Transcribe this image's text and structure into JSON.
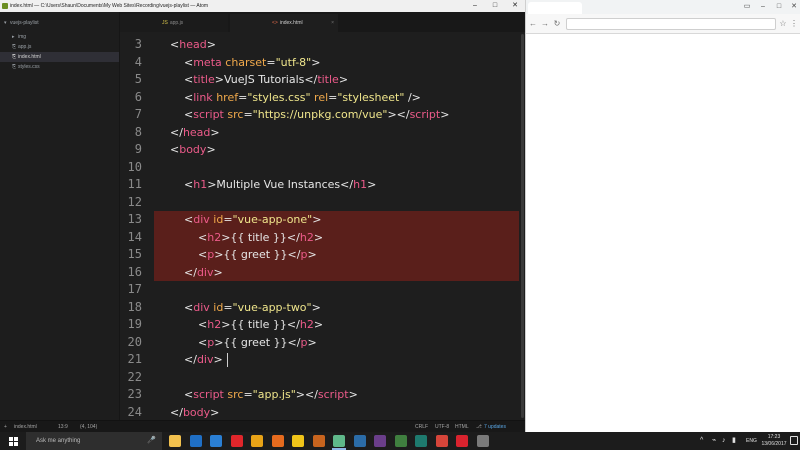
{
  "atom": {
    "title": "index.html — C:\\Users\\Shaun\\Documents\\My Web Sites\\Recording\\vuejs-playlist — Atom",
    "tree": [
      {
        "label": "vuejs-playlist",
        "icon": "folder-open-icon"
      },
      {
        "label": "img",
        "icon": "folder-icon"
      },
      {
        "label": "app.js",
        "icon": "file-js-icon"
      },
      {
        "label": "index.html",
        "icon": "file-html-icon",
        "selected": true
      },
      {
        "label": "styles.css",
        "icon": "file-css-icon"
      }
    ],
    "tabs": [
      {
        "label": "app.js",
        "kind": "js"
      },
      {
        "label": "index.html",
        "kind": "html",
        "active": true
      }
    ],
    "code": [
      {
        "n": "3",
        "indent": 1,
        "tokens": [
          [
            "punc",
            "<"
          ],
          [
            "tag",
            "head"
          ],
          [
            "punc",
            ">"
          ]
        ]
      },
      {
        "n": "4",
        "indent": 2,
        "tokens": [
          [
            "punc",
            "<"
          ],
          [
            "tag",
            "meta"
          ],
          [
            "txt",
            " "
          ],
          [
            "attr",
            "charset"
          ],
          [
            "punc",
            "="
          ],
          [
            "str",
            "\"utf-8\""
          ],
          [
            "punc",
            ">"
          ]
        ]
      },
      {
        "n": "5",
        "indent": 2,
        "tokens": [
          [
            "punc",
            "<"
          ],
          [
            "tag",
            "title"
          ],
          [
            "punc",
            ">"
          ],
          [
            "txt",
            "VueJS Tutorials"
          ],
          [
            "punc",
            "</"
          ],
          [
            "tag",
            "title"
          ],
          [
            "punc",
            ">"
          ]
        ]
      },
      {
        "n": "6",
        "indent": 2,
        "tokens": [
          [
            "punc",
            "<"
          ],
          [
            "tag",
            "link"
          ],
          [
            "txt",
            " "
          ],
          [
            "attr",
            "href"
          ],
          [
            "punc",
            "="
          ],
          [
            "str",
            "\"styles.css\""
          ],
          [
            "txt",
            " "
          ],
          [
            "attr",
            "rel"
          ],
          [
            "punc",
            "="
          ],
          [
            "str",
            "\"stylesheet\""
          ],
          [
            "txt",
            " "
          ],
          [
            "punc",
            "/>"
          ]
        ]
      },
      {
        "n": "7",
        "indent": 2,
        "tokens": [
          [
            "punc",
            "<"
          ],
          [
            "tag",
            "script"
          ],
          [
            "txt",
            " "
          ],
          [
            "attr",
            "src"
          ],
          [
            "punc",
            "="
          ],
          [
            "str",
            "\"https://unpkg.com/vue\""
          ],
          [
            "punc",
            "></"
          ],
          [
            "tag",
            "script"
          ],
          [
            "punc",
            ">"
          ]
        ]
      },
      {
        "n": "8",
        "indent": 1,
        "tokens": [
          [
            "punc",
            "</"
          ],
          [
            "tag",
            "head"
          ],
          [
            "punc",
            ">"
          ]
        ]
      },
      {
        "n": "9",
        "indent": 1,
        "tokens": [
          [
            "punc",
            "<"
          ],
          [
            "tag",
            "body"
          ],
          [
            "punc",
            ">"
          ]
        ]
      },
      {
        "n": "10",
        "indent": 0,
        "tokens": []
      },
      {
        "n": "11",
        "indent": 2,
        "tokens": [
          [
            "punc",
            "<"
          ],
          [
            "tag",
            "h1"
          ],
          [
            "punc",
            ">"
          ],
          [
            "txt",
            "Multiple Vue Instances"
          ],
          [
            "punc",
            "</"
          ],
          [
            "tag",
            "h1"
          ],
          [
            "punc",
            ">"
          ]
        ]
      },
      {
        "n": "12",
        "indent": 0,
        "tokens": []
      },
      {
        "n": "13",
        "indent": 2,
        "hl": true,
        "tokens": [
          [
            "punc",
            "<"
          ],
          [
            "tag",
            "div"
          ],
          [
            "txt",
            " "
          ],
          [
            "attr",
            "id"
          ],
          [
            "punc",
            "="
          ],
          [
            "str",
            "\"vue-app-one\""
          ],
          [
            "punc",
            ">"
          ]
        ]
      },
      {
        "n": "14",
        "indent": 3,
        "hl": true,
        "tokens": [
          [
            "punc",
            "<"
          ],
          [
            "tag",
            "h2"
          ],
          [
            "punc",
            ">"
          ],
          [
            "txt",
            "{{ title }}"
          ],
          [
            "punc",
            "</"
          ],
          [
            "tag",
            "h2"
          ],
          [
            "punc",
            ">"
          ]
        ]
      },
      {
        "n": "15",
        "indent": 3,
        "hl": true,
        "tokens": [
          [
            "punc",
            "<"
          ],
          [
            "tag",
            "p"
          ],
          [
            "punc",
            ">"
          ],
          [
            "txt",
            "{{ greet }}"
          ],
          [
            "punc",
            "</"
          ],
          [
            "tag",
            "p"
          ],
          [
            "punc",
            ">"
          ]
        ]
      },
      {
        "n": "16",
        "indent": 2,
        "hl": true,
        "tokens": [
          [
            "punc",
            "</"
          ],
          [
            "tag",
            "div"
          ],
          [
            "punc",
            ">"
          ]
        ]
      },
      {
        "n": "17",
        "indent": 0,
        "tokens": []
      },
      {
        "n": "18",
        "indent": 2,
        "tokens": [
          [
            "punc",
            "<"
          ],
          [
            "tag",
            "div"
          ],
          [
            "txt",
            " "
          ],
          [
            "attr",
            "id"
          ],
          [
            "punc",
            "="
          ],
          [
            "str",
            "\"vue-app-two\""
          ],
          [
            "punc",
            ">"
          ]
        ]
      },
      {
        "n": "19",
        "indent": 3,
        "tokens": [
          [
            "punc",
            "<"
          ],
          [
            "tag",
            "h2"
          ],
          [
            "punc",
            ">"
          ],
          [
            "txt",
            "{{ title }}"
          ],
          [
            "punc",
            "</"
          ],
          [
            "tag",
            "h2"
          ],
          [
            "punc",
            ">"
          ]
        ]
      },
      {
        "n": "20",
        "indent": 3,
        "tokens": [
          [
            "punc",
            "<"
          ],
          [
            "tag",
            "p"
          ],
          [
            "punc",
            ">"
          ],
          [
            "txt",
            "{{ greet }}"
          ],
          [
            "punc",
            "</"
          ],
          [
            "tag",
            "p"
          ],
          [
            "punc",
            ">"
          ]
        ]
      },
      {
        "n": "21",
        "indent": 2,
        "tokens": [
          [
            "punc",
            "</"
          ],
          [
            "tag",
            "div"
          ],
          [
            "punc",
            ">"
          ]
        ]
      },
      {
        "n": "22",
        "indent": 0,
        "tokens": []
      },
      {
        "n": "23",
        "indent": 2,
        "tokens": [
          [
            "punc",
            "<"
          ],
          [
            "tag",
            "script"
          ],
          [
            "txt",
            " "
          ],
          [
            "attr",
            "src"
          ],
          [
            "punc",
            "="
          ],
          [
            "str",
            "\"app.js\""
          ],
          [
            "punc",
            "></"
          ],
          [
            "tag",
            "script"
          ],
          [
            "punc",
            ">"
          ]
        ]
      },
      {
        "n": "24",
        "indent": 1,
        "tokens": [
          [
            "punc",
            "</"
          ],
          [
            "tag",
            "body"
          ],
          [
            "punc",
            ">"
          ]
        ]
      }
    ],
    "status": {
      "file": "index.html",
      "position": "13:9",
      "selection": "(4, 104)",
      "line_ending": "CRLF",
      "encoding": "UTF-8",
      "grammar": "HTML",
      "updates": "7 updates"
    }
  },
  "browser": {
    "url": ""
  },
  "taskbar": {
    "search_placeholder": "Ask me anything",
    "apps": [
      {
        "name": "file-explorer-icon",
        "color": "#f2c14e"
      },
      {
        "name": "outlook-icon",
        "color": "#1f6fc5"
      },
      {
        "name": "app-icon-blue",
        "color": "#2a7fd4"
      },
      {
        "name": "opera-icon",
        "color": "#e0262b"
      },
      {
        "name": "chrome-icon",
        "color": "#e8a317"
      },
      {
        "name": "firefox-icon",
        "color": "#e66b1e"
      },
      {
        "name": "app-icon-yellow",
        "color": "#f0c419"
      },
      {
        "name": "app-icon-orange",
        "color": "#c8641e"
      },
      {
        "name": "atom-icon",
        "color": "#5fb88a",
        "active": true
      },
      {
        "name": "photoshop-icon",
        "color": "#2b6ca8"
      },
      {
        "name": "premiere-icon",
        "color": "#6a3e8a"
      },
      {
        "name": "terminal-icon",
        "color": "#3f7f3f"
      },
      {
        "name": "audition-icon",
        "color": "#1e7a6e"
      },
      {
        "name": "app-icon-red",
        "color": "#d6453a"
      },
      {
        "name": "recorder-icon",
        "color": "#d9232e"
      },
      {
        "name": "app-icon-grey",
        "color": "#7a7a7a"
      }
    ],
    "lang": "ENG",
    "time": "17:23",
    "date": "13/06/2017"
  }
}
